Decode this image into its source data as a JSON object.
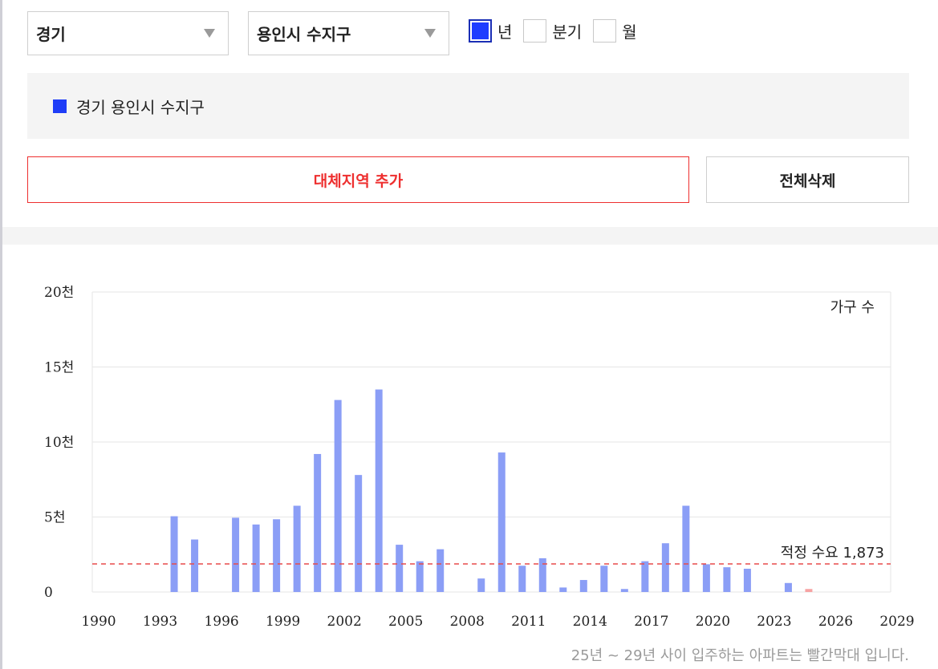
{
  "filters": {
    "region": "경기",
    "district": "용인시 수지구",
    "periods": [
      {
        "label": "년",
        "checked": true
      },
      {
        "label": "분기",
        "checked": false
      },
      {
        "label": "월",
        "checked": false
      }
    ]
  },
  "legend": {
    "label": "경기 용인시 수지구",
    "color": "#1f3df7"
  },
  "buttons": {
    "add_region": "대체지역 추가",
    "clear_all": "전체삭제"
  },
  "footnote": "25년 ~ 29년 사이 입주하는 아파트는 빨간막대 입니다.",
  "chart_data": {
    "type": "bar",
    "unit_label": "가구 수",
    "x": [
      1990,
      1991,
      1992,
      1993,
      1994,
      1995,
      1996,
      1997,
      1998,
      1999,
      2000,
      2001,
      2002,
      2003,
      2004,
      2005,
      2006,
      2007,
      2008,
      2009,
      2010,
      2011,
      2012,
      2013,
      2014,
      2015,
      2016,
      2017,
      2018,
      2019,
      2020,
      2021,
      2022,
      2023,
      2024,
      2025,
      2026,
      2027,
      2028,
      2029
    ],
    "values": [
      0,
      0,
      0,
      0,
      5050,
      3500,
      0,
      4950,
      4500,
      4850,
      5750,
      9200,
      12800,
      7800,
      13500,
      3150,
      2050,
      2850,
      0,
      900,
      9300,
      1750,
      2250,
      300,
      800,
      1750,
      200,
      2050,
      3250,
      5750,
      1850,
      1650,
      1550,
      0,
      600,
      200,
      0,
      0,
      0,
      0
    ],
    "future_years": [
      2025,
      2026,
      2027,
      2028,
      2029
    ],
    "bar_color": "#8b9ef6",
    "future_bar_color": "#f7a3a3",
    "x_ticks": [
      1990,
      1993,
      1996,
      1999,
      2002,
      2005,
      2008,
      2011,
      2014,
      2017,
      2020,
      2023,
      2026,
      2029
    ],
    "y_ticks": [
      {
        "value": 0,
        "label": "0"
      },
      {
        "value": 5000,
        "label": "5천"
      },
      {
        "value": 10000,
        "label": "10천"
      },
      {
        "value": 15000,
        "label": "15천"
      },
      {
        "value": 20000,
        "label": "20천"
      }
    ],
    "ylim": [
      0,
      20000
    ],
    "reference_line": {
      "value": 1873,
      "label": "적정 수요 1,873",
      "color": "#e84a4a"
    },
    "grid": true
  }
}
